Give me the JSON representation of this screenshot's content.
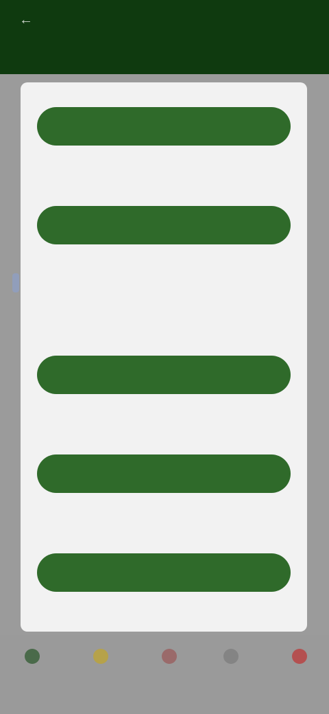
{
  "appbar": {
    "back_glyph": "←",
    "title": "",
    "action": ""
  },
  "dialog": {
    "options": [
      {
        "button_label": "",
        "description": ""
      },
      {
        "button_label": "",
        "description": ""
      },
      {
        "button_label": "",
        "description": ""
      },
      {
        "button_label": "",
        "description": ""
      },
      {
        "button_label": "",
        "description": ""
      }
    ]
  },
  "bottom_nav": {
    "items": [
      {
        "label": "",
        "icon": "home-icon",
        "color": "#4a6a4a"
      },
      {
        "label": "",
        "icon": "star-icon",
        "color": "#b6a24a"
      },
      {
        "label": "",
        "icon": "heart-icon",
        "color": "#9a6a6a"
      },
      {
        "label": "",
        "icon": "grid-icon",
        "color": "#848484"
      },
      {
        "label": "",
        "icon": "profile-icon",
        "color": "#b45050"
      }
    ]
  },
  "colors": {
    "appbar": "#0f3a0f",
    "button": "#2f6a2a",
    "dialog": "#f2f2f2",
    "scrim": "#9b9b9b"
  }
}
